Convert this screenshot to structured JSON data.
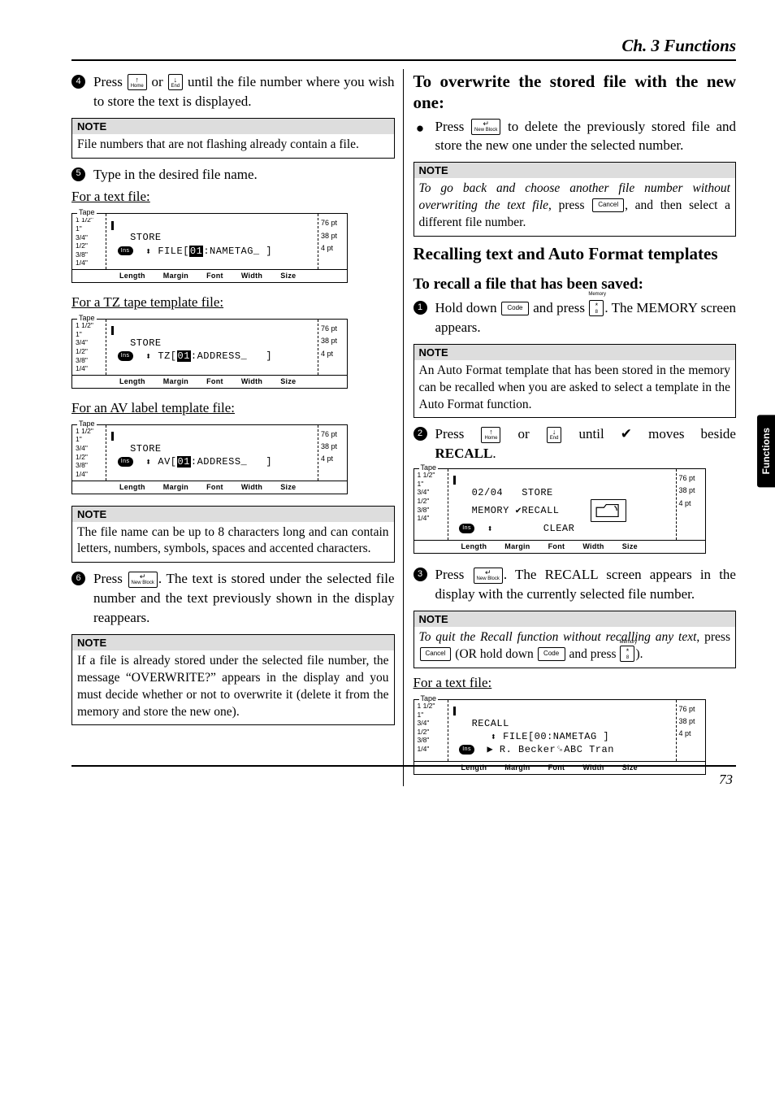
{
  "chapter": "Ch. 3 Functions",
  "side_tab": "Functions",
  "page_number": "73",
  "keys": {
    "up_top": "↑",
    "up_bottom": "Home",
    "down_top": "↓",
    "down_bottom": "End",
    "enter_top": "↵",
    "enter_bottom": "New Block",
    "cancel": "Cancel",
    "code": "Code",
    "star_top": "*",
    "star_bottom": "8",
    "star_sup": "Memory"
  },
  "lcd_common": {
    "tape_title": "Tape",
    "tapes": [
      "1 1/2\"",
      "1\"",
      "3/4\"",
      "1/2\"",
      "3/8\"",
      "1/4\""
    ],
    "pts": [
      "76 pt",
      "38 pt",
      "4 pt"
    ],
    "ins": "Ins",
    "footer": [
      "Length",
      "Margin",
      "Font",
      "Width",
      "Size"
    ]
  },
  "left": {
    "step4": {
      "a": "Press ",
      "b": " or ",
      "c": " until the file number where you wish to store the text is displayed."
    },
    "note1": {
      "title": "NOTE",
      "body": "File numbers that are not flashing already contain a file."
    },
    "step5": "Type in the desired file name.",
    "h_text": "For a text file:",
    "h_tz": "For a TZ tape template file:",
    "h_av": "For an AV label template file:",
    "lcd1": {
      "l1": "STORE",
      "arrow": "⬍",
      "l2a": " FILE[",
      "l2b": "01",
      "l2c": ":NAMETAG_ ]"
    },
    "lcd2": {
      "l1": "STORE",
      "arrow": "⬍",
      "l2a": " TZ[",
      "l2b": "01",
      "l2c": ":ADDRESS_   ]"
    },
    "lcd3": {
      "l1": "STORE",
      "arrow": "⬍",
      "l2a": " AV[",
      "l2b": "01",
      "l2c": ":ADDRESS_   ]"
    },
    "note2": {
      "title": "NOTE",
      "body": "The file name can be up to 8 characters long and can contain letters, numbers, symbols, spaces and accented characters."
    },
    "step6": {
      "a": "Press ",
      "b": ". The text is stored under the selected file number and the text previously shown in the display reappears."
    },
    "note3": {
      "title": "NOTE",
      "body": "If a file is already stored under the selected file number, the message “OVERWRITE?” appears in the display and you must decide whether or not to overwrite it (delete it from the memory and store the new one)."
    }
  },
  "right": {
    "h_overwrite": "To overwrite the stored file with the new one:",
    "overwrite_step": {
      "a": "Press ",
      "b": " to delete the previously stored file and store the new one under the selected number."
    },
    "note4": {
      "title": "NOTE",
      "a": "To go back and choose another file number without overwriting the text file",
      "b": ", press ",
      "c": ", and then select a different file number."
    },
    "h_recall_section": "Recalling text and Auto Format tem­plates",
    "h_recall_sub": "To recall a file that has been saved:",
    "step1": {
      "a": "Hold down ",
      "b": " and press ",
      "c": ". The MEM­ORY screen appears."
    },
    "note5": {
      "title": "NOTE",
      "body": "An Auto Format template that has been stored in the memory can be recalled when you are asked to select a template in the Auto Format function."
    },
    "step2": {
      "a": "Press ",
      "b": " or ",
      "c": " until ",
      "d": " moves beside ",
      "e": "RECALL",
      "f": "."
    },
    "lcd_mem": {
      "l1": "02/04   STORE",
      "l2a": "MEMORY ",
      "l2b": "✔",
      "l2c": "RECALL",
      "arrow": "⬍",
      "l3": "        CLEAR"
    },
    "step3": {
      "a": "Press ",
      "b": ". The RECALL screen appears in the display with the currently selected file num­ber."
    },
    "note6": {
      "title": "NOTE",
      "a": "To quit the Recall function without recalling any text",
      "b": ", press ",
      "c": " (OR hold down ",
      "d": " and press ",
      "e": ")."
    },
    "h_text2": "For a text file:",
    "lcd_recall": {
      "l1": "RECALL",
      "arrow": "⬍",
      "l2": " FILE[00:NAMETAG ]",
      "tri": "▶",
      "l3": " R. Becker␍ABC Tran"
    }
  }
}
